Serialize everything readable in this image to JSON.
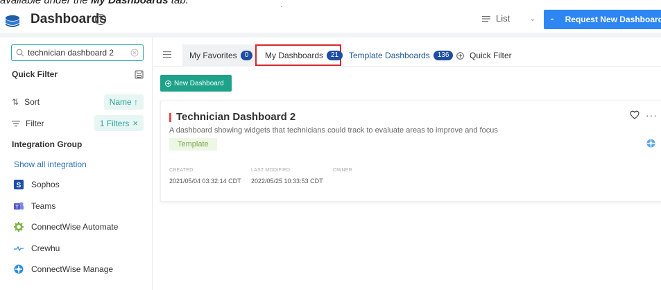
{
  "caption": {
    "lead": "available under the ",
    "bold": "My Dashboards",
    "tail": " tab."
  },
  "header": {
    "title": "Dashboards",
    "view_label": "List",
    "request_button": "Request New Dashboard"
  },
  "sidebar": {
    "search_value": "technician dashboard 2",
    "quick_filter_title": "Quick Filter",
    "sort_label": "Sort",
    "sort_value": "Name ↑",
    "filter_label": "Filter",
    "filter_value": "1 Filters",
    "integration_group_title": "Integration Group",
    "show_all": "Show all integration",
    "integrations": [
      {
        "label": "Sophos",
        "icon": "sophos-icon"
      },
      {
        "label": "Teams",
        "icon": "teams-icon"
      },
      {
        "label": "ConnectWise Automate",
        "icon": "connectwise-automate-icon"
      },
      {
        "label": "Crewhu",
        "icon": "crewhu-icon"
      },
      {
        "label": "ConnectWise Manage",
        "icon": "connectwise-manage-icon"
      }
    ]
  },
  "tabs": [
    {
      "label": "My Favorites",
      "count": "0"
    },
    {
      "label": "My Dashboards",
      "count": "21"
    },
    {
      "label": "Template Dashboards",
      "count": "136"
    },
    {
      "label": "Quick Filter"
    }
  ],
  "main": {
    "new_button": "New Dashboard"
  },
  "card": {
    "title": "Technician Dashboard 2",
    "description": "A dashboard showing widgets that technicians could track to evaluate areas to improve and focus",
    "tag": "Template",
    "created_label": "CREATED",
    "created_value": "2021/05/04 03:32:14 CDT",
    "modified_label": "LAST MODIFIED",
    "modified_value": "2022/05/25 10:33:53 CDT",
    "owner_label": "OWNER"
  },
  "colors": {
    "accent_teal": "#1ea38a",
    "badge_blue": "#1f4ea1",
    "request_blue": "#2e86f2",
    "highlight_red": "#d4272f"
  }
}
